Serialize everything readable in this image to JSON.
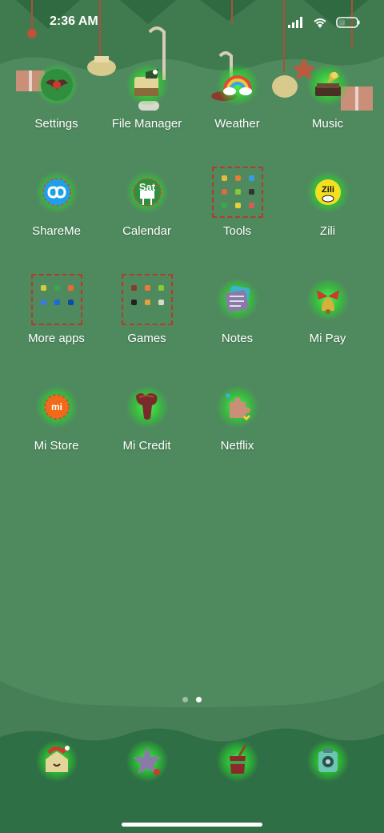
{
  "status_bar": {
    "time": "2:36 AM"
  },
  "apps": [
    {
      "label": "Settings",
      "icon": "bat-gear-icon"
    },
    {
      "label": "File Manager",
      "icon": "cake-folder-icon"
    },
    {
      "label": "Weather",
      "icon": "rainbow-cloud-icon"
    },
    {
      "label": "Music",
      "icon": "gramophone-icon"
    },
    {
      "label": "ShareMe",
      "icon": "shareme-icon"
    },
    {
      "label": "Calendar",
      "icon": "calendar-sign-icon",
      "badge": "Sat"
    },
    {
      "label": "Tools",
      "icon": "folder-icon"
    },
    {
      "label": "Zili",
      "icon": "zili-icon",
      "badge": "Zili"
    },
    {
      "label": "More apps",
      "icon": "folder-icon"
    },
    {
      "label": "Games",
      "icon": "folder-icon"
    },
    {
      "label": "Notes",
      "icon": "notes-stack-icon"
    },
    {
      "label": "Mi Pay",
      "icon": "bell-bow-icon"
    },
    {
      "label": "Mi Store",
      "icon": "mi-store-icon",
      "badge": "mi"
    },
    {
      "label": "Mi Credit",
      "icon": "mi-credit-icon"
    },
    {
      "label": "Netflix",
      "icon": "puzzle-icon"
    }
  ],
  "page_indicator": {
    "total": 2,
    "active": 2
  },
  "dock": [
    {
      "icon": "santa-house-icon"
    },
    {
      "icon": "star-icon"
    },
    {
      "icon": "gift-cup-icon"
    },
    {
      "icon": "camera-icon"
    }
  ]
}
